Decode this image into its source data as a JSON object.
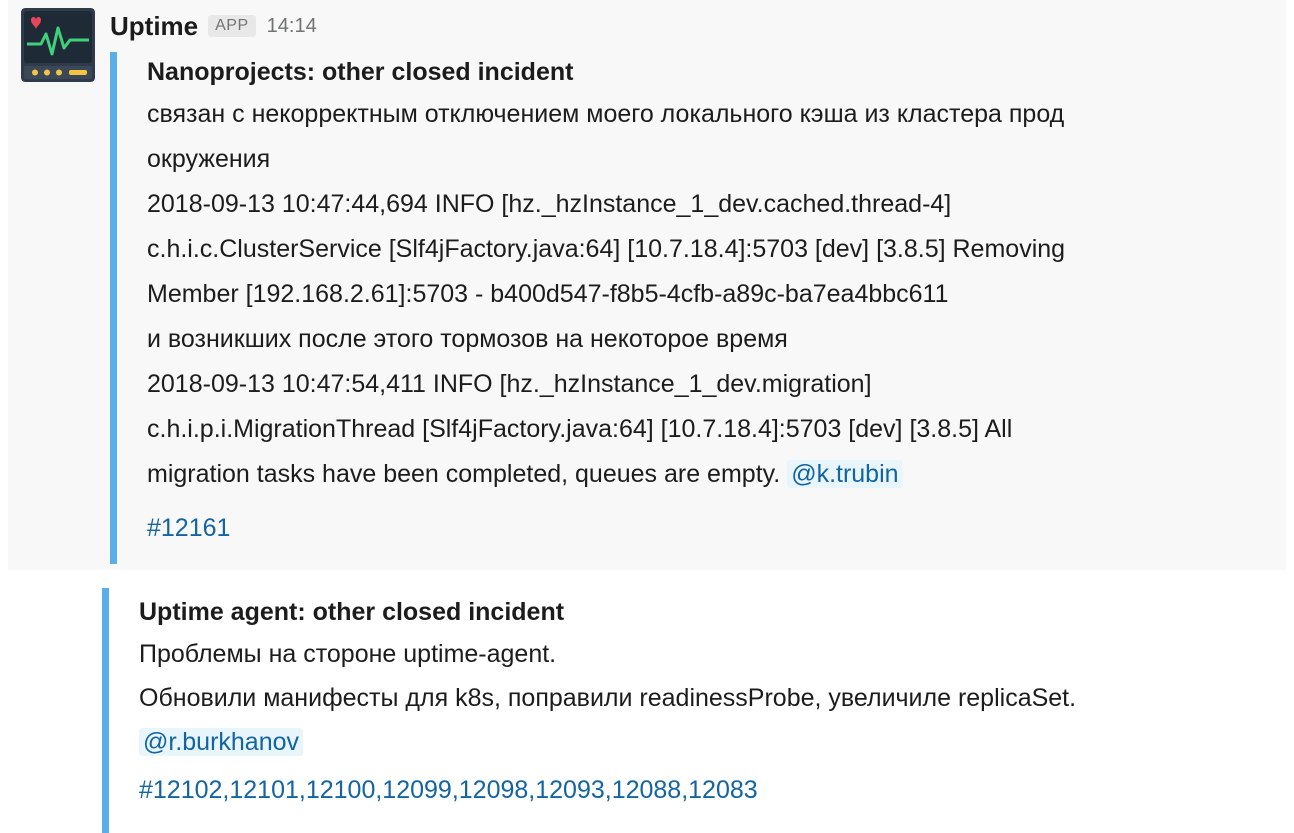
{
  "message": {
    "sender": "Uptime",
    "badge": "APP",
    "time": "14:14",
    "avatar_icon": "uptime-monitor-icon"
  },
  "attachments": [
    {
      "title": "Nanoprojects: other closed incident",
      "lines": [
        "связан с некорректным отключением моего локального кэша из кластера прод",
        "окружения",
        "2018-09-13 10:47:44,694 INFO [hz._hzInstance_1_dev.cached.thread-4]",
        "c.h.i.c.ClusterService [Slf4jFactory.java:64] [10.7.18.4]:5703 [dev] [3.8.5] Removing",
        "Member [192.168.2.61]:5703 - b400d547-f8b5-4cfb-a89c-ba7ea4bbc611",
        "и возникших после этого тормозов на некоторое время",
        "2018-09-13 10:47:54,411 INFO [hz._hzInstance_1_dev.migration]",
        "c.h.i.p.i.MigrationThread [Slf4jFactory.java:64] [10.7.18.4]:5703 [dev] [3.8.5] All"
      ],
      "last_line_text": "migration tasks have been completed, queues are empty.",
      "mention": "@k.trubin",
      "link": "#12161"
    },
    {
      "title": "Uptime agent: other closed incident",
      "lines": [
        "Проблемы на стороне uptime-agent.",
        "Обновили манифесты для k8s, поправили readinessProbe, увеличиле replicaSet."
      ],
      "mention": "@r.burkhanov",
      "link": "#12102,12101,12100,12099,12098,12093,12088,12083"
    }
  ],
  "colors": {
    "attachment_bar": "#5aaeea",
    "link": "#1264a3",
    "mention_bg": "#e8f5fa",
    "hover_bg": "#f8f8f8"
  }
}
